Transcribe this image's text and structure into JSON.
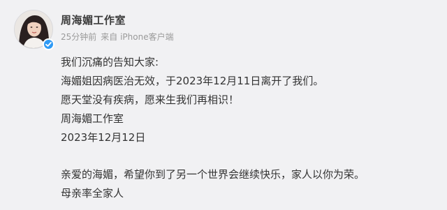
{
  "post": {
    "author_name": "周海媚工作室",
    "meta": {
      "time": "25分钟前",
      "source": "来自 iPhone客户端"
    },
    "verified": true,
    "paragraph_1": [
      "我们沉痛的告知大家:",
      "海媚姐因病医治无效，于2023年12月11日离开了我们。",
      "愿天堂没有疾病，愿来生我们再相识！",
      "周海媚工作室",
      "2023年12月12日"
    ],
    "paragraph_2": [
      "亲爱的海媚，希望你到了另一个世界会继续快乐，家人以你为荣。",
      "母亲率全家人"
    ]
  },
  "colors": {
    "background": "#f1f1f3",
    "author": "#3b3b3b",
    "meta": "#9a9a9a",
    "body_text": "#333333",
    "verify_badge": "#2f9af5"
  },
  "icons": {
    "verify": "verified-check-icon"
  }
}
